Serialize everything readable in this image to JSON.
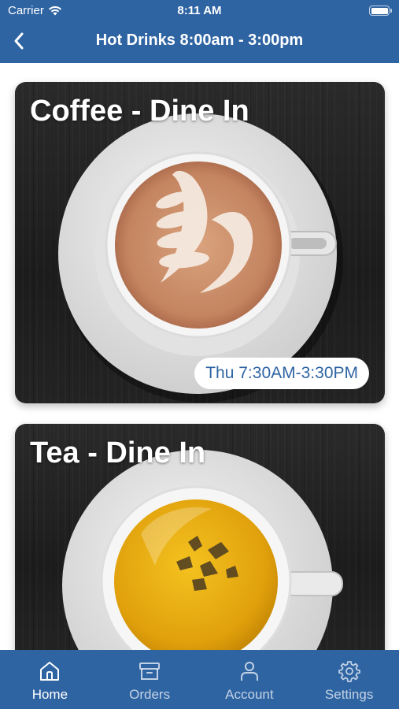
{
  "status_bar": {
    "carrier": "Carrier",
    "time": "8:11 AM"
  },
  "nav": {
    "title": "Hot Drinks 8:00am - 3:00pm"
  },
  "cards": [
    {
      "title": "Coffee - Dine In",
      "hours": "Thu 7:30AM-3:30PM"
    },
    {
      "title": "Tea - Dine In"
    }
  ],
  "tabs": [
    {
      "label": "Home",
      "icon": "home-icon",
      "active": true
    },
    {
      "label": "Orders",
      "icon": "archive-box-icon",
      "active": false
    },
    {
      "label": "Account",
      "icon": "person-icon",
      "active": false
    },
    {
      "label": "Settings",
      "icon": "gear-icon",
      "active": false
    }
  ],
  "colors": {
    "brand_blue": "#2f64a3",
    "white": "#ffffff"
  }
}
